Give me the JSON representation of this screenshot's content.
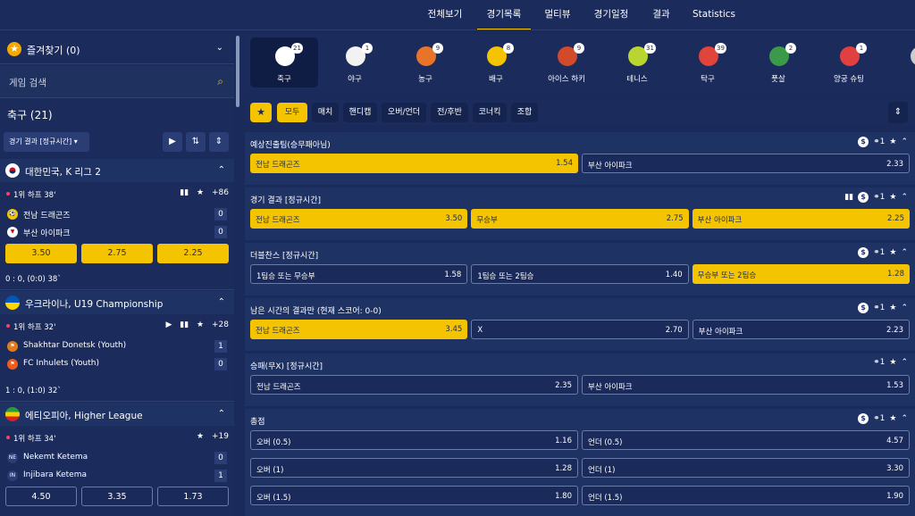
{
  "topnav": {
    "tabs": [
      "전체보기",
      "경기목록",
      "멀티뷰",
      "경기일정",
      "결과",
      "Statistics"
    ],
    "active": "경기목록"
  },
  "left": {
    "favorites_label": "즐겨찾기 (0)",
    "search_placeholder": "게임 검색",
    "sport_title": "축구 (21)",
    "filter_label": "경기 결과 [정규시간]",
    "leagues": [
      {
        "name": "대한민국, K 리그 2",
        "period": "1위 하프 38'",
        "more": "+86",
        "home": "전남 드래곤즈",
        "home_score": "0",
        "away": "부산 아이파크",
        "away_score": "0",
        "odds": [
          "3.50",
          "2.75",
          "2.25"
        ],
        "result": "0 : 0, (0:0) 38`"
      },
      {
        "name": "우크라이나, U19 Championship",
        "period": "1위 하프 32'",
        "more": "+28",
        "home": "Shakhtar Donetsk (Youth)",
        "home_score": "1",
        "away": "FC Inhulets (Youth)",
        "away_score": "0",
        "result": "1 : 0, (1:0) 32`"
      },
      {
        "name": "에티오피아, Higher League",
        "period": "1위 하프 34'",
        "more": "+19",
        "home": "Nekemt Ketema",
        "home_logo": "NE",
        "home_score": "0",
        "away": "Injibara Ketema",
        "away_logo": "IN",
        "away_score": "1",
        "odds": [
          "4.50",
          "3.35",
          "1.73"
        ]
      }
    ]
  },
  "sports": [
    {
      "label": "축구",
      "count": "21",
      "color": "#ffffff"
    },
    {
      "label": "야구",
      "count": "1",
      "color": "#f2f2f2"
    },
    {
      "label": "농구",
      "count": "9",
      "color": "#e8742a"
    },
    {
      "label": "배구",
      "count": "8",
      "color": "#f5c400"
    },
    {
      "label": "아이스 하키",
      "count": "9",
      "color": "#d14a2a"
    },
    {
      "label": "테니스",
      "count": "31",
      "color": "#b9d630"
    },
    {
      "label": "탁구",
      "count": "39",
      "color": "#e0443a"
    },
    {
      "label": "풋살",
      "count": "2",
      "color": "#3a9a4a"
    },
    {
      "label": "양궁 슈팅",
      "count": "1",
      "color": "#e04040"
    },
    {
      "label": "",
      "count": "",
      "color": "#cccccc"
    }
  ],
  "chips": [
    "모두",
    "매치",
    "핸디캡",
    "오버/언더",
    "전/후반",
    "코너킥",
    "조합"
  ],
  "markets": [
    {
      "title": "예상진출팀(승무패아님)",
      "link": "1",
      "rows": [
        [
          {
            "name": "전남 드래곤즈",
            "odds": "1.54",
            "sel": true
          },
          {
            "name": "부산 아이파크",
            "odds": "2.33",
            "sel": false
          }
        ]
      ]
    },
    {
      "title": "경기 결과 [정규시간]",
      "link": "1",
      "rows": [
        [
          {
            "name": "전남 드래곤즈",
            "odds": "3.50",
            "sel": true
          },
          {
            "name": "무승부",
            "odds": "2.75",
            "sel": true
          },
          {
            "name": "부산 아이파크",
            "odds": "2.25",
            "sel": true
          }
        ]
      ]
    },
    {
      "title": "더블찬스 [정규시간]",
      "link": "1",
      "rows": [
        [
          {
            "name": "1팀승 또는 무승부",
            "odds": "1.58",
            "sel": false
          },
          {
            "name": "1팀승 또는 2팀승",
            "odds": "1.40",
            "sel": false
          },
          {
            "name": "무승부 또는 2팀승",
            "odds": "1.28",
            "sel": true
          }
        ]
      ]
    },
    {
      "title": "남은 시간의 결과만 (현재 스코어: 0-0)",
      "link": "1",
      "rows": [
        [
          {
            "name": "전남 드래곤즈",
            "odds": "3.45",
            "sel": true
          },
          {
            "name": "X",
            "odds": "2.70",
            "sel": false
          },
          {
            "name": "부산 아이파크",
            "odds": "2.23",
            "sel": false
          }
        ]
      ]
    },
    {
      "title": "승패(무X) [정규시간]",
      "link": "1",
      "rows": [
        [
          {
            "name": "전남 드래곤즈",
            "odds": "2.35",
            "sel": false
          },
          {
            "name": "부산 아이파크",
            "odds": "1.53",
            "sel": false
          }
        ]
      ]
    },
    {
      "title": "총점",
      "link": "1",
      "rows": [
        [
          {
            "name": "오버 (0.5)",
            "odds": "1.16",
            "sel": false
          },
          {
            "name": "언더 (0.5)",
            "odds": "4.57",
            "sel": false
          }
        ],
        [
          {
            "name": "오버 (1)",
            "odds": "1.28",
            "sel": false
          },
          {
            "name": "언더 (1)",
            "odds": "3.30",
            "sel": false
          }
        ],
        [
          {
            "name": "오버 (1.5)",
            "odds": "1.80",
            "sel": false
          },
          {
            "name": "언더 (1.5)",
            "odds": "1.90",
            "sel": false
          }
        ]
      ]
    }
  ]
}
